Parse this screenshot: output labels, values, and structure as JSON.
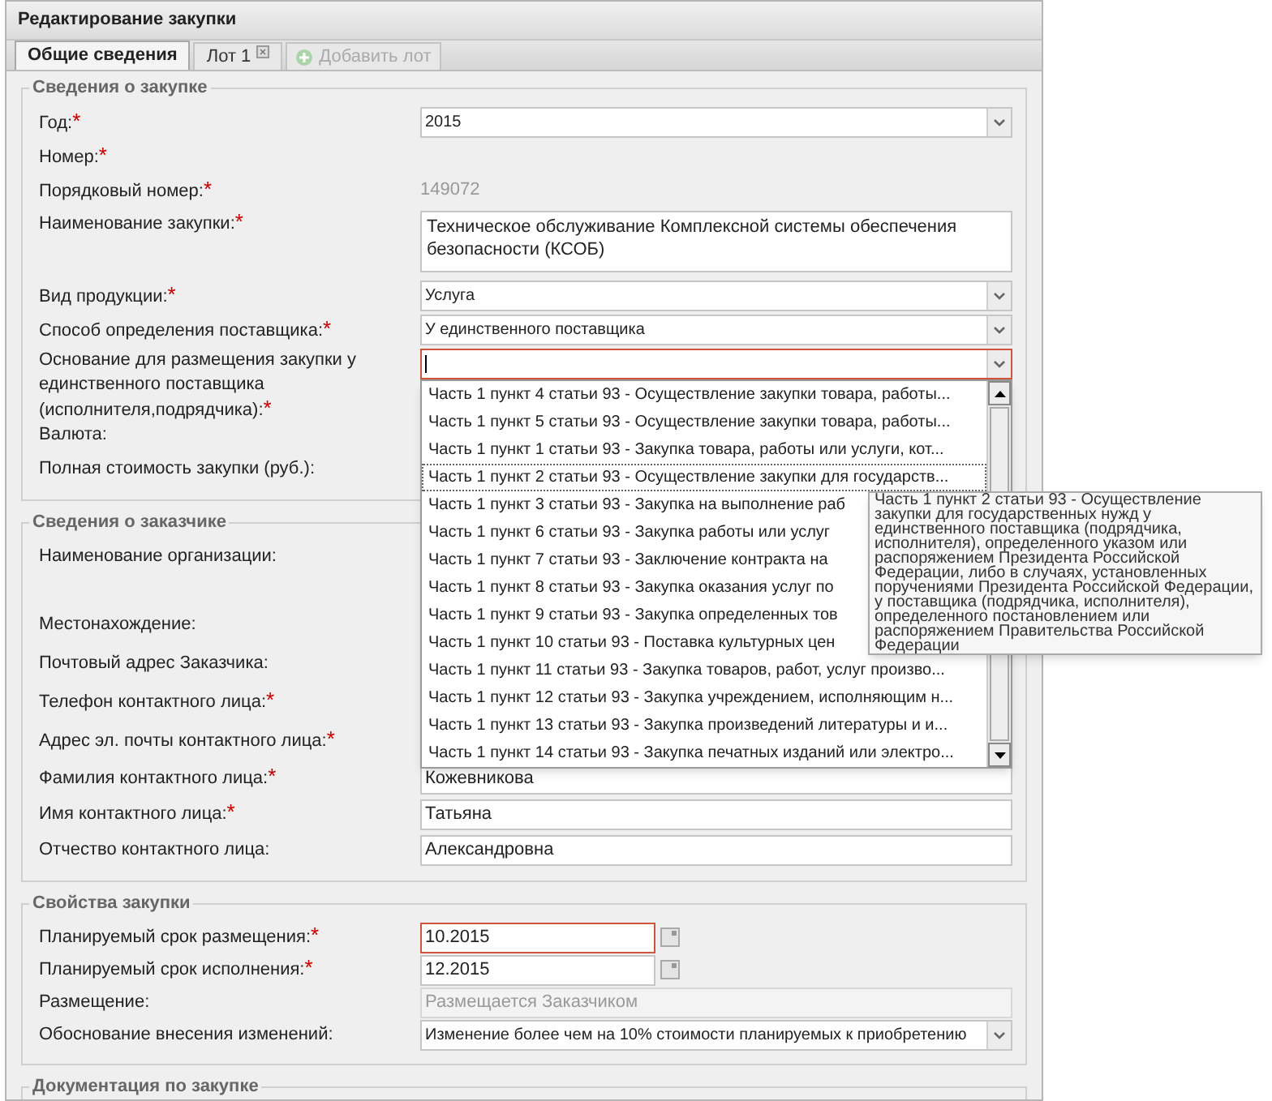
{
  "window": {
    "title": "Редактирование закупки"
  },
  "tabs": [
    {
      "label": "Общие сведения",
      "selected": true,
      "closable": false
    },
    {
      "label": "Лот 1",
      "selected": false,
      "closable": true
    }
  ],
  "add_tab_button": {
    "label": "Добавить лот",
    "disabled": true
  },
  "required_mark": "*",
  "sections": [
    {
      "title": "Сведения о закупке",
      "fields": [
        {
          "label": "Год:",
          "required": true,
          "kind": "select",
          "value": "2015"
        },
        {
          "label": "Номер:",
          "required": true,
          "kind": "label"
        },
        {
          "label": "Порядковый номер:",
          "required": true,
          "kind": "static",
          "value": "149072"
        },
        {
          "label": "Наименование закупки:",
          "required": true,
          "kind": "textarea",
          "value": "Техническое обслуживание Комплексной системы обеспечения безопасности (КСОБ)"
        },
        {
          "label": "Вид продукции:",
          "required": true,
          "kind": "select",
          "value": "Услуга"
        },
        {
          "label": "Способ определения поставщика:",
          "required": true,
          "kind": "select",
          "value": "У единственного поставщика"
        },
        {
          "label": "Основание для размещения закупки у единственного поставщика (исполнителя,подрядчика):",
          "required": true,
          "kind": "select",
          "invalid": true,
          "expanded": true,
          "options": [
            {
              "label": "Часть 1 пункт 4 статьи 93 - Осуществление закупки товара, работы...",
              "selected": false
            },
            {
              "label": "Часть 1 пункт 5 статьи 93 - Осуществление закупки товара, работы...",
              "selected": false
            },
            {
              "label": "Часть 1 пункт 1 статьи 93 - Закупка товара, работы или услуги, кот...",
              "selected": false
            },
            {
              "label": "Часть 1 пункт 2 статьи 93 - Осуществление закупки для государств...",
              "selected": true
            },
            {
              "label": "Часть 1 пункт 3 статьи 93 - Закупка на выполнение раб",
              "selected": false
            },
            {
              "label": "Часть 1 пункт 6 статьи 93 - Закупка работы или услуг",
              "selected": false
            },
            {
              "label": "Часть 1 пункт 7 статьи 93 - Заключение контракта на",
              "selected": false
            },
            {
              "label": "Часть 1 пункт 8 статьи 93 - Закупка оказания услуг по",
              "selected": false
            },
            {
              "label": "Часть 1 пункт 9 статьи 93 - Закупка определенных тов",
              "selected": false
            },
            {
              "label": "Часть 1 пункт 10 статьи 93 - Поставка культурных цен",
              "selected": false
            },
            {
              "label": "Часть 1 пункт 11 статьи 93 - Закупка товаров, работ, услуг произво...",
              "selected": false
            },
            {
              "label": "Часть 1 пункт 12 статьи 93 - Закупка учреждением, исполняющим н...",
              "selected": false
            },
            {
              "label": "Часть 1 пункт 13 статьи 93 - Закупка произведений литературы и и...",
              "selected": false
            },
            {
              "label": "Часть 1 пункт 14 статьи 93 - Закупка печатных изданий или электро...",
              "selected": false
            }
          ],
          "tooltip": "Часть 1 пункт 2 статьи 93 - Осуществление закупки для государственных нужд у единственного поставщика (подрядчика, исполнителя), определенного указом или распоряжением Президента Российской Федерации, либо в случаях, установленных поручениями Президента Российской Федерации, у поставщика (подрядчика, исполнителя), определенного постановлением или распоряжением Правительства Российской Федерации"
        },
        {
          "label": "Валюта:",
          "required": false,
          "kind": "label"
        },
        {
          "label": "Полная стоимость закупки (руб.):",
          "required": false,
          "kind": "label"
        }
      ]
    },
    {
      "title": "Сведения о заказчике",
      "fields": [
        {
          "label": "Наименование организации:",
          "required": false,
          "kind": "label",
          "tall": true
        },
        {
          "label": "Местонахождение:",
          "required": false,
          "kind": "label"
        },
        {
          "label": "Почтовый адрес Заказчика:",
          "required": false,
          "kind": "label"
        },
        {
          "label": "Телефон контактного лица:",
          "required": true,
          "kind": "label"
        },
        {
          "label": "Адрес эл. почты контактного лица:",
          "required": true,
          "kind": "label"
        },
        {
          "label": "Фамилия контактного лица:",
          "required": true,
          "kind": "text",
          "value": "Кожевникова"
        },
        {
          "label": "Имя контактного лица:",
          "required": true,
          "kind": "text",
          "value": "Татьяна"
        },
        {
          "label": "Отчество контактного лица:",
          "required": false,
          "kind": "text",
          "value": "Александровна"
        }
      ]
    },
    {
      "title": "Свойства закупки",
      "fields": [
        {
          "label": "Планируемый срок размещения:",
          "required": true,
          "kind": "date",
          "value": "10.2015",
          "invalid": true
        },
        {
          "label": "Планируемый срок исполнения:",
          "required": true,
          "kind": "date",
          "value": "12.2015"
        },
        {
          "label": "Размещение:",
          "required": false,
          "kind": "readonly",
          "value": "Размещается Заказчиком"
        },
        {
          "label": "Обоснование внесения изменений:",
          "required": false,
          "kind": "select",
          "value": "Изменение более чем на 10% стоимости планируемых к приобретению"
        }
      ]
    },
    {
      "title": "Документация по закупке"
    }
  ]
}
